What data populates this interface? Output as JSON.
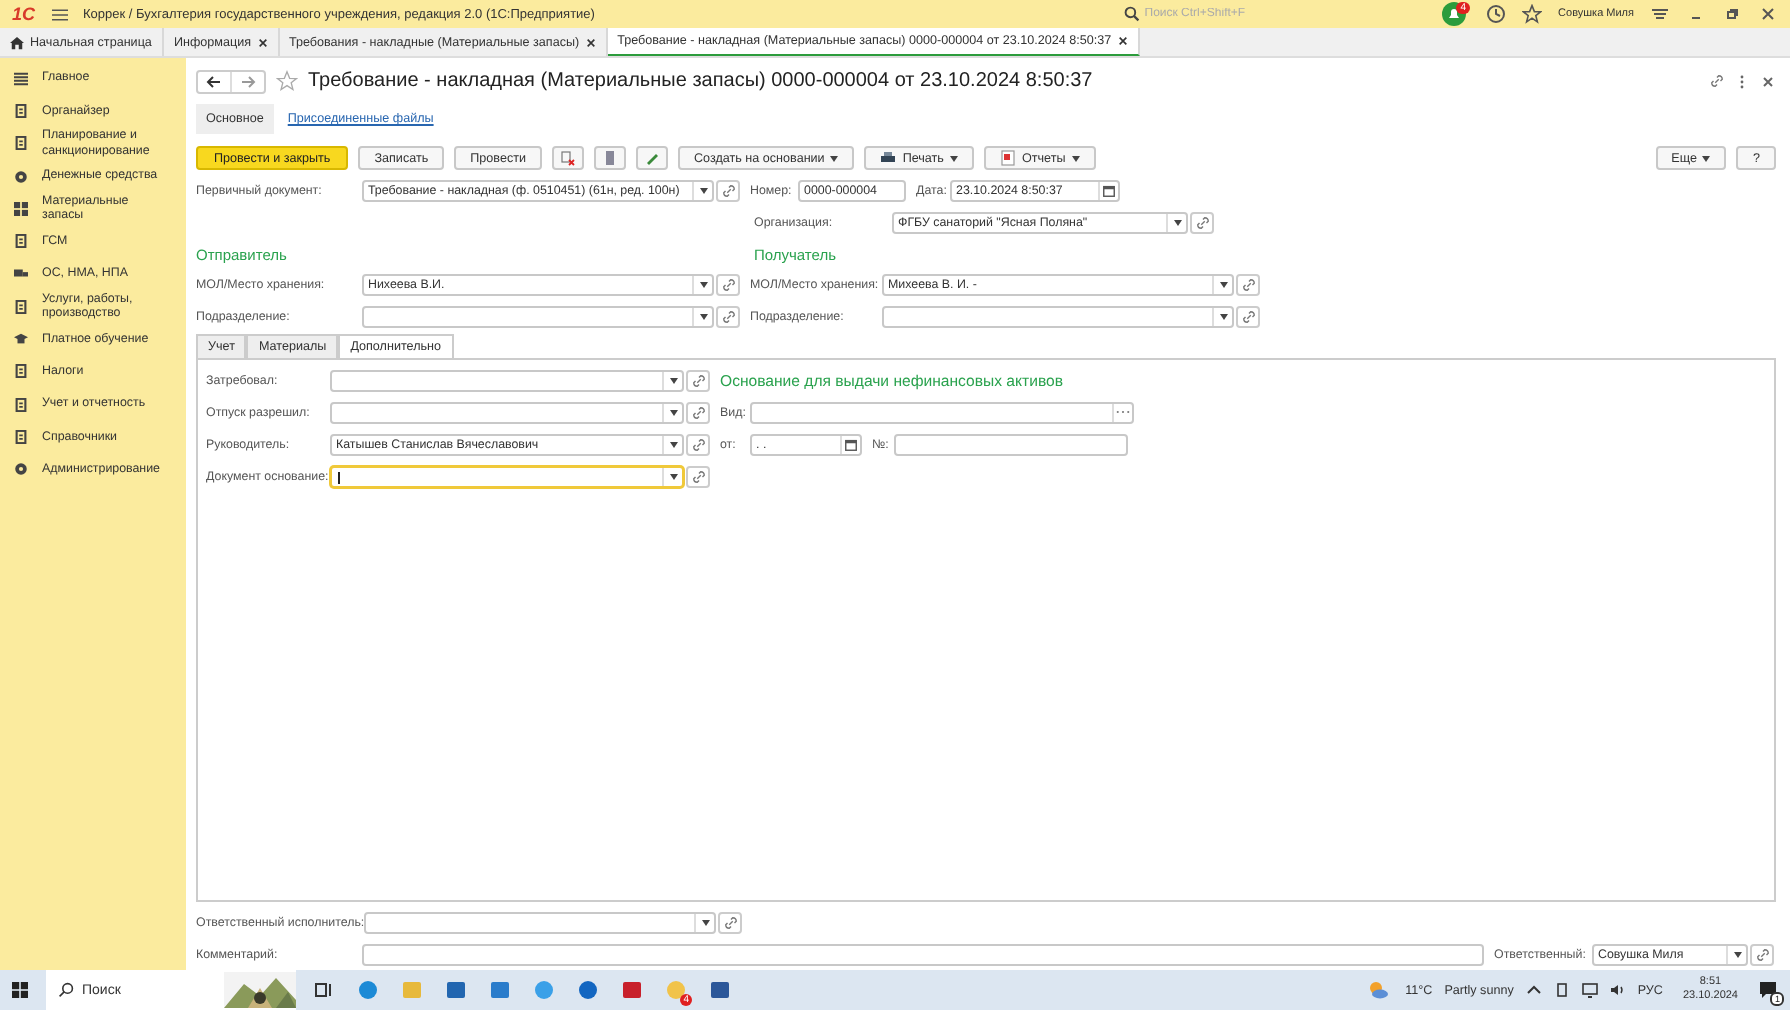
{
  "app": {
    "logo": "1С",
    "title": "Коррек / Бухгалтерия государственного учреждения, редакция 2.0  (1С:Предприятие)",
    "search_placeholder": "Поиск Ctrl+Shift+F",
    "notification_count": "4",
    "user": "Совушка Миля"
  },
  "open_tabs": [
    {
      "label": "Начальная страница",
      "kind": "home",
      "selected": false
    },
    {
      "label": "Информация",
      "kind": "closable",
      "selected": false
    },
    {
      "label": "Требования - накладные (Материальные запасы)",
      "kind": "closable",
      "selected": false
    },
    {
      "label": "Требование - накладная (Материальные запасы) 0000-000004 от 23.10.2024 8:50:37",
      "kind": "closable",
      "selected": true
    }
  ],
  "sidebar": [
    {
      "label": "Главное"
    },
    {
      "label": "Органайзер"
    },
    {
      "label": "Планирование и санкционирование"
    },
    {
      "label": "Денежные средства"
    },
    {
      "label": "Материальные запасы"
    },
    {
      "label": "ГСМ"
    },
    {
      "label": "ОС, НМА, НПА"
    },
    {
      "label": "Услуги, работы, производство"
    },
    {
      "label": "Платное обучение"
    },
    {
      "label": "Налоги"
    },
    {
      "label": "Учет и отчетность"
    },
    {
      "label": "Справочники"
    },
    {
      "label": "Администрирование"
    }
  ],
  "document": {
    "title": "Требование - накладная (Материальные запасы) 0000-000004 от 23.10.2024 8:50:37",
    "view_tabs": [
      {
        "label": "Основное",
        "selected": true
      },
      {
        "label": "Присоединенные файлы",
        "selected": false
      }
    ],
    "toolbar": [
      {
        "kind": "primary",
        "label": "Провести и закрыть"
      },
      {
        "kind": "normal",
        "label": "Записать"
      },
      {
        "kind": "normal",
        "label": "Провести"
      },
      {
        "kind": "icon"
      },
      {
        "kind": "icon"
      },
      {
        "kind": "icon"
      },
      {
        "kind": "menu",
        "label": "Создать на основании"
      },
      {
        "kind": "menu",
        "label": "Печать"
      },
      {
        "kind": "menu",
        "label": "Отчеты"
      }
    ],
    "toolbar_right": [
      {
        "kind": "menu",
        "label": "Еще"
      },
      {
        "kind": "normal",
        "label": "?"
      }
    ],
    "primary_document": {
      "label": "Первичный документ:",
      "value": "Требование - накладная (ф. 0510451) (61н, ред. 100н)",
      "kind": "select"
    },
    "number": {
      "label": "Номер:",
      "value": "0000-000004",
      "kind": "text"
    },
    "date": {
      "label": "Дата:",
      "value": "23.10.2024  8:50:37",
      "kind": "date"
    },
    "organization": {
      "label": "Организация:",
      "value": "ФГБУ санаторий \"Ясная Поляна\"",
      "kind": "select"
    },
    "sender": {
      "heading": "Отправитель",
      "fields": [
        {
          "label": "МОЛ/Место хранения:",
          "value": "Нихеева В.И.",
          "kind": "select"
        },
        {
          "label": "Подразделение:",
          "kind": "select"
        }
      ]
    },
    "receiver": {
      "heading": "Получатель",
      "fields": [
        {
          "label": "МОЛ/Место хранения:",
          "value": "Михеева В. И. -",
          "kind": "select"
        },
        {
          "label": "Подразделение:",
          "kind": "select"
        }
      ]
    },
    "inner_tabs": [
      {
        "label": "Учет",
        "selected": false
      },
      {
        "label": "Материалы",
        "selected": false
      },
      {
        "label": "Дополнительно",
        "selected": true
      }
    ],
    "panel_fields": [
      {
        "label": "Затребовал:",
        "kind": "select",
        "focused": false
      },
      {
        "label": "Отпуск разрешил:",
        "kind": "select",
        "focused": false
      },
      {
        "label": "Руководитель:",
        "value": "Катышев Станислав Вячеславович",
        "kind": "select",
        "focused": false
      },
      {
        "label": "Документ основание:",
        "kind": "select",
        "focused": true
      }
    ],
    "basis": {
      "heading": "Основание для выдачи нефинансовых активов",
      "kind_field": {
        "label": "Вид:",
        "kind": "choice"
      },
      "date_field": {
        "label": "от:",
        "value": " .  .",
        "kind": "date"
      },
      "number_field": {
        "label": "№:",
        "kind": "text"
      }
    },
    "responsible_executor": {
      "label": "Ответственный исполнитель:",
      "kind": "select"
    },
    "comment": {
      "label": "Комментарий:",
      "kind": "text"
    },
    "responsible": {
      "label": "Ответственный:",
      "value": "Совушка Миля",
      "kind": "select"
    }
  },
  "taskbar": {
    "search_placeholder": "Поиск",
    "app_badge": "4",
    "temperature": "11°C",
    "weather": "Partly sunny",
    "language": "РУС",
    "time": "8:51",
    "date": "23.10.2024",
    "notification_count": "1"
  }
}
